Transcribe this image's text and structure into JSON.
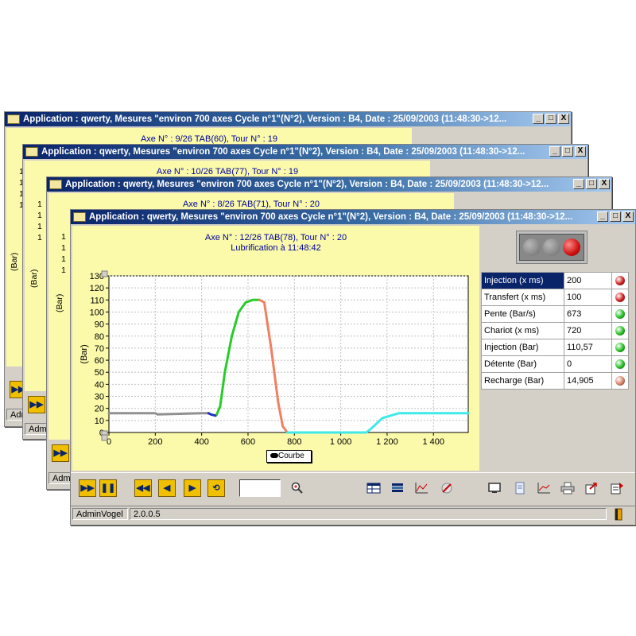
{
  "windows": [
    {
      "title": "Application : qwerty, Mesures \"environ 700 axes Cycle n°1\"(N°2), Version : B4, Date : 25/09/2003 (11:48:30->12...",
      "subtitle": "Axe N° : 9/26 TAB(60), Tour N° : 19",
      "ylabel": "(Bar)",
      "ticks": [
        "1",
        "1",
        "1",
        "1"
      ],
      "user": "Admin"
    },
    {
      "title": "Application : qwerty, Mesures \"environ 700 axes Cycle n°1\"(N°2), Version : B4, Date : 25/09/2003 (11:48:30->12...",
      "subtitle": "Axe N° : 10/26 TAB(77), Tour N° : 19",
      "ylabel": "(Bar)",
      "ticks": [
        "1",
        "1",
        "1",
        "1"
      ],
      "user": "Admin"
    },
    {
      "title": "Application : qwerty, Mesures \"environ 700 axes Cycle n°1\"(N°2), Version : B4, Date : 25/09/2003 (11:48:30->12...",
      "subtitle": "Axe N° : 8/26 TAB(71), Tour N° : 20",
      "ylabel": "(Bar)",
      "ticks": [
        "1",
        "1",
        "1",
        "1"
      ],
      "user": "Admin"
    }
  ],
  "front": {
    "title": "Application : qwerty, Mesures \"environ 700 axes Cycle n°1\"(N°2), Version : B4, Date : 25/09/2003 (11:48:30->12...",
    "subtitle1": "Axe N° : 12/26 TAB(78), Tour N° : 20",
    "subtitle2": "Lubrification à 11:48:42",
    "status_user": "AdminVogel",
    "status_version": "2.0.0.5",
    "controls": {
      "minimize": "_",
      "maximize": "□",
      "close": "X"
    }
  },
  "measurements": [
    {
      "name": "Injection (x ms)",
      "value": "200",
      "status": "red",
      "selected": true
    },
    {
      "name": "Transfert (x ms)",
      "value": "100",
      "status": "red"
    },
    {
      "name": "Pente (Bar/s)",
      "value": "673",
      "status": "green"
    },
    {
      "name": "Chariot (x ms)",
      "value": "720",
      "status": "green"
    },
    {
      "name": "Injection (Bar)",
      "value": "110,57",
      "status": "green"
    },
    {
      "name": "Détente (Bar)",
      "value": "0",
      "status": "green"
    },
    {
      "name": "Recharge (Bar)",
      "value": "14,905",
      "status": "orange"
    }
  ],
  "colors": {
    "red": "#d01818",
    "green": "#20c020",
    "orange": "#d88060"
  },
  "icons": [
    "play-forward-icon",
    "pause-icon",
    "first-icon",
    "prev-icon",
    "next-icon",
    "cycle-icon",
    "zoom-icon",
    "table-icon",
    "db-icon",
    "chart-icon",
    "pen-icon",
    "monitor-icon",
    "document-icon",
    "graph-icon",
    "printer-icon",
    "export-icon",
    "exit-icon"
  ],
  "chart_data": {
    "type": "line",
    "ylabel": "(Bar)",
    "xlim": [
      0,
      1550
    ],
    "ylim": [
      0,
      130
    ],
    "xticks": [
      0,
      200,
      400,
      600,
      800,
      1000,
      1200,
      1400
    ],
    "xtick_labels": [
      "0",
      "200",
      "400",
      "600",
      "800",
      "1 000",
      "1 200",
      "1 400"
    ],
    "yticks": [
      0,
      10,
      20,
      30,
      40,
      50,
      60,
      70,
      80,
      90,
      100,
      110,
      120,
      130
    ],
    "legend": "Courbe",
    "series": [
      {
        "color": "#909090",
        "x": [
          0,
          200,
          210,
          400,
          430
        ],
        "y": [
          16,
          16,
          15,
          16,
          16
        ]
      },
      {
        "color": "#2030c0",
        "x": [
          430,
          440,
          460,
          465
        ],
        "y": [
          16,
          15,
          14,
          15
        ]
      },
      {
        "color": "#28cc28",
        "x": [
          465,
          480,
          500,
          530,
          560,
          590,
          620,
          640,
          650
        ],
        "y": [
          15,
          22,
          50,
          80,
          100,
          108,
          110,
          110,
          110
        ]
      },
      {
        "color": "#f08060",
        "x": [
          650,
          670,
          700,
          730,
          750,
          770
        ],
        "y": [
          110,
          108,
          70,
          25,
          5,
          0
        ]
      },
      {
        "color": "#40e8e8",
        "x": [
          770,
          800,
          1000,
          1110,
          1130,
          1180,
          1250,
          1350,
          1450,
          1550
        ],
        "y": [
          0,
          0,
          0,
          0,
          3,
          12,
          16,
          16,
          16,
          16
        ]
      }
    ]
  }
}
